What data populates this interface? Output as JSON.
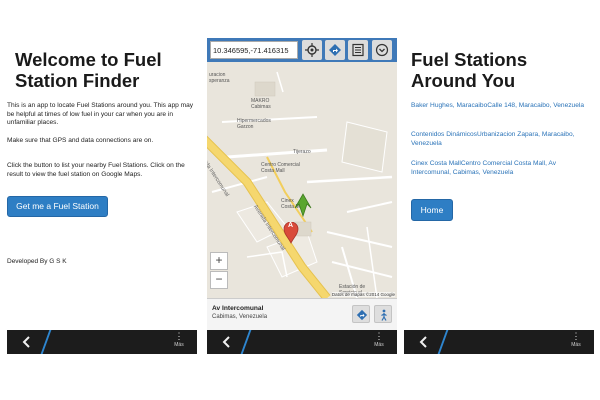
{
  "screen1": {
    "title": "Welcome to Fuel Station Finder",
    "intro": "This is an app to locate Fuel Stations around you. This app may be helpful at times of low fuel in your car when you are in unfamiliar places.",
    "gps_note": "Make sure that GPS and data connections are on.",
    "instructions": "Click the button to list your nearby Fuel Stations. Click on the result to view the fuel station on Google Maps.",
    "button_label": "Get me a Fuel Station",
    "developer": "Developed By G S K"
  },
  "screen2": {
    "coordinates": "10.346595,-71.416315",
    "map_labels": {
      "uracion": "uracion\nsperanza",
      "makro": "MAKRO\nCabimas",
      "hipermercado": "Hipermercados\nGarzon",
      "tijerazo": "Tijerazo",
      "centro": "Centro Comercial\nCosta Mall",
      "cinex": "Cinex\nCosta Mall",
      "avenida1": "Avenida Intercomunal",
      "avenida2": "Avenida Intercomunal",
      "estacion": "Estación de\nServicio el...",
      "marker": "A"
    },
    "zoom_in": "+",
    "zoom_out": "−",
    "copyright": "Datos de mapas ©2014 Google",
    "place_name": "Av Intercomunal",
    "place_location": "Cabimas, Venezuela"
  },
  "screen3": {
    "title": "Fuel Stations Around You",
    "stations": [
      "Baker Hughes, MaracaiboCalle 148, Maracaibo, Venezuela",
      "Contenidos DinámicosUrbanizacion Zapara, Maracaibo, Venezuela",
      "Cinex Costa MallCentro Comercial Costa Mall, Av Intercomunal, Cabimas, Venezuela"
    ],
    "button_label": "Home"
  },
  "actionbar": {
    "more_label": "Más",
    "dots": "⋮"
  },
  "colors": {
    "accent": "#2e7ec4",
    "link": "#2a73b8",
    "bar": "#1c1c1c",
    "map_road": "#f5d76e",
    "marker": "#d94a3a"
  }
}
